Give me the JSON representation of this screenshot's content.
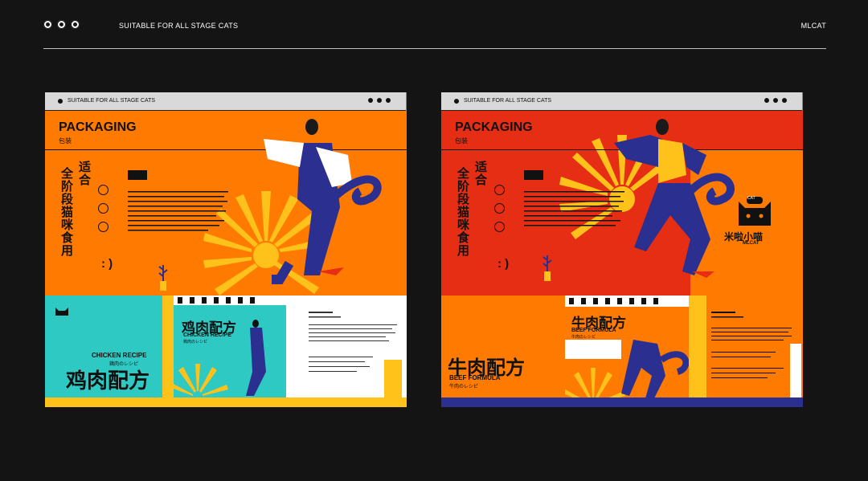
{
  "header": {
    "tagline": "SUITABLE FOR ALL STAGE CATS",
    "brand": "MLCAT"
  },
  "panels": [
    {
      "window_title": "SUITABLE FOR ALL STAGE CATS",
      "title": "PACKAGING",
      "subtitle": "包装",
      "vertical_col1": "全阶段猫咪食用",
      "vertical_col2": "适合",
      "smile": ": )",
      "recipe_en": "CHICKEN RECIPE",
      "recipe_jp": "鶏肉のレシピ",
      "recipe_cn": "鸡肉配方",
      "colors": {
        "main": "#ff7a00",
        "accent": "#2fc9c4",
        "sun": "#ffc21a",
        "figure": "#2b2f8f"
      }
    },
    {
      "window_title": "SUITABLE FOR ALL STAGE CATS",
      "title": "PACKAGING",
      "subtitle": "包装",
      "vertical_col1": "全阶段猫咪食用",
      "vertical_col2": "适合",
      "smile": ": )",
      "recipe_en": "BEEF FORMULA",
      "recipe_jp": "牛肉のレシピ",
      "recipe_cn": "牛肉配方",
      "logo_cn": "米啦小喵",
      "logo_en": "MLCAT",
      "logo_badge": "CAT",
      "colors": {
        "main": "#e52e14",
        "accent": "#ff7a00",
        "sun": "#ffc21a",
        "figure": "#2b2f8f"
      }
    }
  ]
}
